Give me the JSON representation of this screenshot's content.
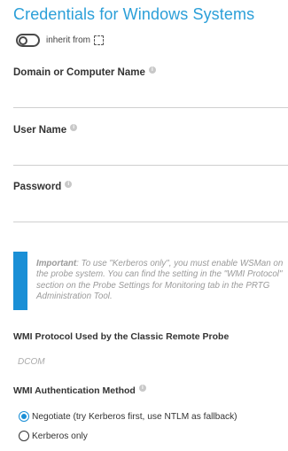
{
  "section": {
    "title": "Credentials for Windows Systems",
    "inherit_label": "inherit from"
  },
  "fields": {
    "domain": {
      "label": "Domain or Computer Name",
      "value": ""
    },
    "username": {
      "label": "User Name",
      "value": ""
    },
    "password": {
      "label": "Password",
      "value": ""
    }
  },
  "note": {
    "important": "Important",
    "text": ": To use \"Kerberos only\", you must enable WSMan on the probe system. You can find the setting in the \"WMI Protocol\" section on the Probe Settings for Monitoring tab in the PRTG Administration Tool."
  },
  "wmi_protocol": {
    "label": "WMI Protocol Used by the Classic Remote Probe",
    "value": "DCOM"
  },
  "wmi_auth": {
    "label": "WMI Authentication Method",
    "options": [
      {
        "label": "Negotiate (try Kerberos first, use NTLM as fallback)",
        "selected": true
      },
      {
        "label": "Kerberos only",
        "selected": false
      }
    ]
  },
  "colors": {
    "accent": "#1a8fd6",
    "title": "#2b9fd8"
  },
  "icons": {
    "toggle": "toggle-off",
    "inherit": "dashed-square-icon",
    "info": "info-icon"
  }
}
